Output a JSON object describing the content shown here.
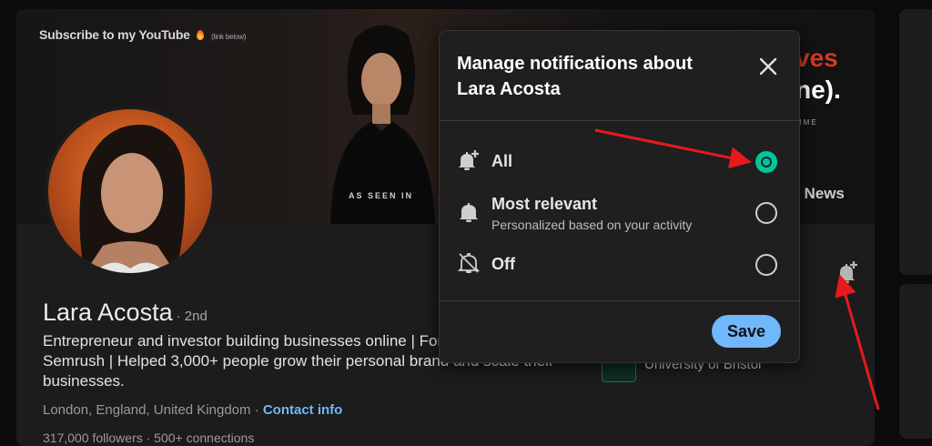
{
  "banner": {
    "youtube_text": "Subscribe to my YouTube",
    "youtube_small": "(link below)",
    "seen_in": "AS SEEN IN",
    "headline_fragment_1": "ves",
    "headline_fragment_2": "ne).",
    "headline_fragment_3": "MME"
  },
  "profile": {
    "name": "Lara Acosta",
    "degree": "· 2nd",
    "headline": "Entrepreneur and investor building businesses online | Forbes, Kajabi + Semrush | Helped 3,000+ people grow their personal brand and scale their businesses.",
    "location": "London, England, United Kingdom ·",
    "contact_info": "Contact info",
    "followers": "317,000 followers · 500+ connections",
    "company": "University of Bristol",
    "news_link": "| News"
  },
  "modal": {
    "title": "Manage notifications about Lara Acosta",
    "options": [
      {
        "label": "All",
        "sub": "",
        "icon": "bell-plus-icon",
        "selected": true
      },
      {
        "label": "Most relevant",
        "sub": "Personalized based on your activity",
        "icon": "bell-icon",
        "selected": false
      },
      {
        "label": "Off",
        "sub": "",
        "icon": "bell-off-icon",
        "selected": false
      }
    ],
    "save_label": "Save"
  },
  "colors": {
    "accent_blue": "#71b7fb",
    "selected_green": "#01c69d",
    "arrow_red": "#e8191d"
  }
}
